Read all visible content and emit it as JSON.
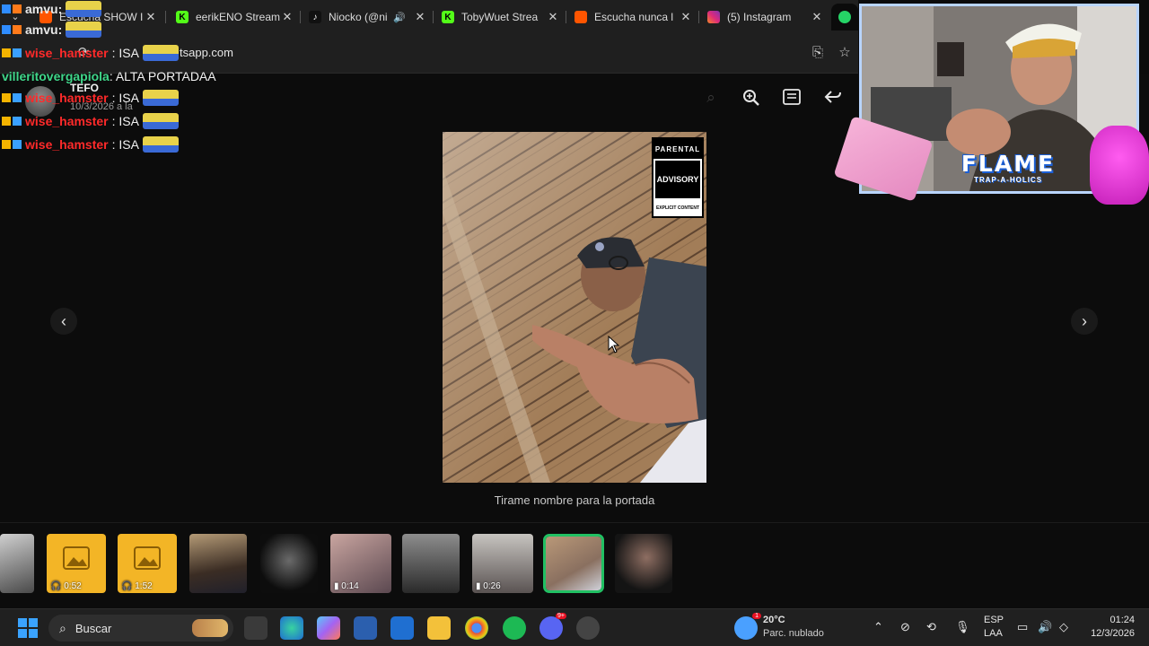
{
  "browser": {
    "tabs": [
      {
        "title": "Escucha SHOW I",
        "color": "#ff5500",
        "close": "✕"
      },
      {
        "title": "eerikENO Stream",
        "color": "#53fc18",
        "close": "✕"
      },
      {
        "title": "Niocko (@ni",
        "color": "#111111",
        "close": "✕"
      },
      {
        "title": "TobyWuet Strea",
        "color": "#53fc18",
        "close": "✕"
      },
      {
        "title": "Escucha nunca l",
        "color": "#ff5500",
        "close": "✕"
      },
      {
        "title": "(5) Instagram",
        "color": "#d62976",
        "close": "✕"
      }
    ],
    "url": "tsapp.com"
  },
  "chat": {
    "lines": [
      {
        "user": "amvu:",
        "color": "#ffffff",
        "text": ""
      },
      {
        "user": "amvu:",
        "color": "#ffffff",
        "text": ""
      },
      {
        "user": "wise_hamster",
        "color": "#ff2a2a",
        "text": ": ISA"
      },
      {
        "user": "villeritovergapiola",
        "color": "#3fd68a",
        "text": ": ALTA PORTADAA"
      },
      {
        "user": "wise_hamster",
        "color": "#ff2a2a",
        "text": ": ISA"
      },
      {
        "user": "wise_hamster",
        "color": "#ff2a2a",
        "text": ": ISA"
      },
      {
        "user": "wise_hamster",
        "color": "#ff2a2a",
        "text": ": ISA"
      }
    ]
  },
  "viewer": {
    "sender_name": "TEFO",
    "sender_date": "10/3/2026 a la",
    "caption": "Tirame nombre para la portada",
    "advisory": {
      "line1": "PARENTAL",
      "line2": "ADVISORY",
      "line3": "EXPLICIT CONTENT"
    },
    "prev_arrow": "‹",
    "next_arrow": "›"
  },
  "thumbnails": [
    {
      "type": "photo",
      "duration": ""
    },
    {
      "type": "audio",
      "duration": "0:52"
    },
    {
      "type": "audio",
      "duration": "1:52"
    },
    {
      "type": "photo",
      "duration": ""
    },
    {
      "type": "photo",
      "duration": ""
    },
    {
      "type": "video",
      "duration": "0:14"
    },
    {
      "type": "photo",
      "duration": ""
    },
    {
      "type": "video",
      "duration": "0:26"
    },
    {
      "type": "photo",
      "duration": "",
      "selected": true
    },
    {
      "type": "photo",
      "duration": ""
    }
  ],
  "overlay": {
    "flame_title": "FLAME",
    "flame_subtitle": "TRAP-A-HOLICS"
  },
  "taskbar": {
    "search_placeholder": "Buscar",
    "weather_temp": "20°C",
    "weather_desc": "Parc. nublado",
    "weather_alert": "1",
    "lang1": "ESP",
    "lang2": "LAA",
    "time": "01:24",
    "date": "12/3/2026",
    "discord_badge": "9+"
  }
}
